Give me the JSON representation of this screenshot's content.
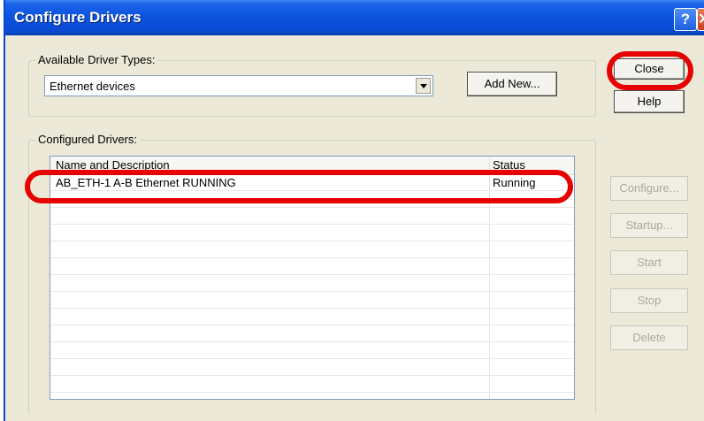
{
  "window": {
    "title": "Configure Drivers",
    "help_button": "?",
    "close_glyph": "✕"
  },
  "available_driver_types": {
    "label": "Available Driver Types:",
    "selected_value": "Ethernet devices",
    "add_new_label": "Add New..."
  },
  "configured_drivers": {
    "label": "Configured Drivers:",
    "columns": [
      "Name and Description",
      "Status"
    ],
    "rows": [
      {
        "name": "AB_ETH-1  A-B Ethernet  RUNNING",
        "status": "Running"
      }
    ]
  },
  "side_buttons": {
    "close": "Close",
    "help": "Help",
    "configure": "Configure...",
    "startup": "Startup...",
    "start": "Start",
    "stop": "Stop",
    "delete": "Delete"
  },
  "colors": {
    "titlebar": "#0b53dd",
    "dialog_bg": "#ece9d8",
    "annotation_red": "#e60000"
  },
  "icons": {
    "help": "question-mark-icon",
    "close": "close-x-icon",
    "dropdown": "chevron-down-icon"
  }
}
